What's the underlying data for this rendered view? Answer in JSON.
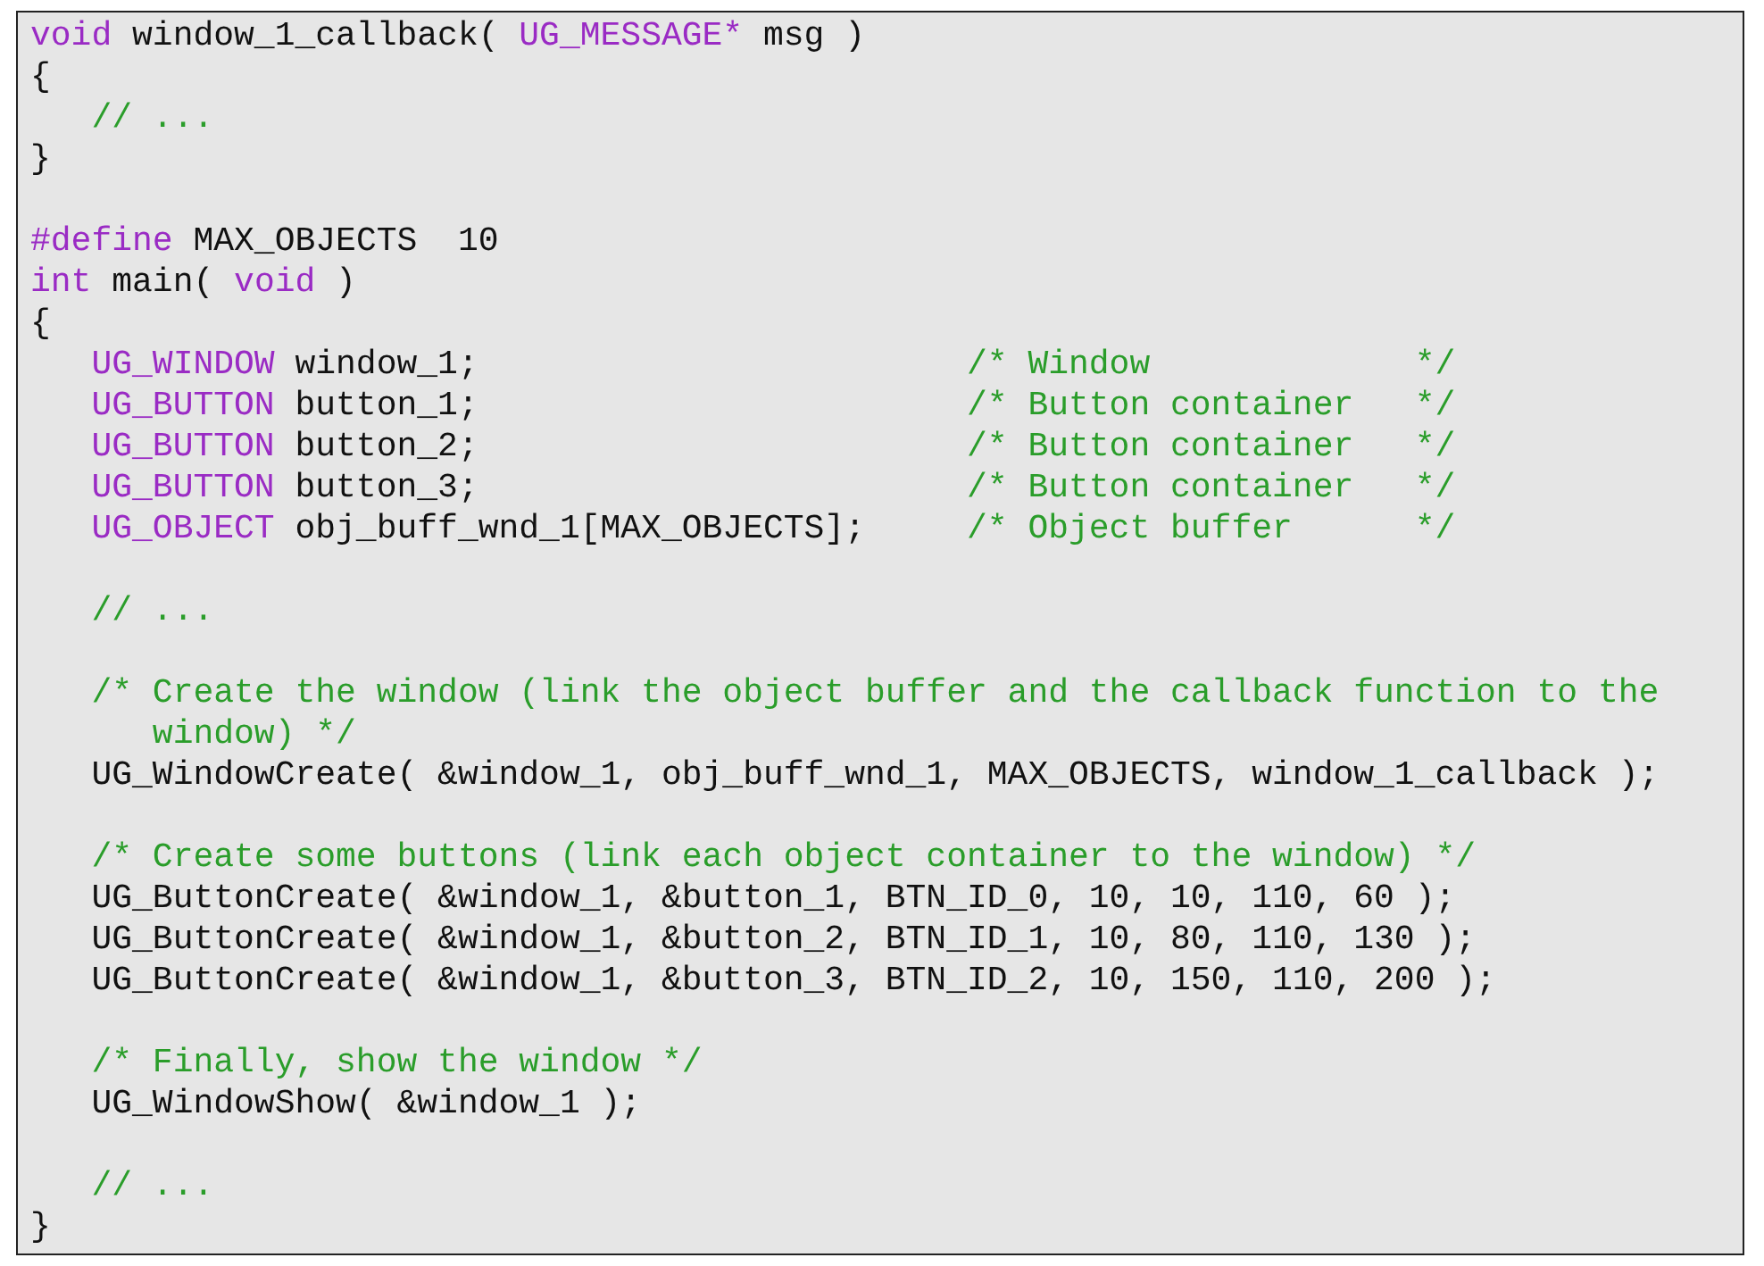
{
  "listing": {
    "blocks": [
      {
        "lines": [
          {
            "segments": [
              {
                "kind": "keyword",
                "text": "void"
              },
              {
                "kind": "plain",
                "text": " window_1_callback( "
              },
              {
                "kind": "type",
                "text": "UG_MESSAGE*"
              },
              {
                "kind": "plain",
                "text": " msg )"
              }
            ]
          },
          {
            "segments": [
              {
                "kind": "plain",
                "text": "{"
              }
            ]
          },
          {
            "segments": [
              {
                "kind": "comment",
                "text": "   // ..."
              }
            ]
          },
          {
            "segments": [
              {
                "kind": "plain",
                "text": "}"
              }
            ]
          }
        ]
      },
      {
        "lines": [
          {
            "segments": [
              {
                "kind": "keyword",
                "text": "#define"
              },
              {
                "kind": "plain",
                "text": " MAX_OBJECTS  10"
              }
            ]
          },
          {
            "segments": [
              {
                "kind": "keyword",
                "text": "int"
              },
              {
                "kind": "plain",
                "text": " main( "
              },
              {
                "kind": "keyword",
                "text": "void"
              },
              {
                "kind": "plain",
                "text": " )"
              }
            ]
          },
          {
            "segments": [
              {
                "kind": "plain",
                "text": "{"
              }
            ]
          },
          {
            "segments": [
              {
                "kind": "type",
                "text": "   UG_WINDOW"
              },
              {
                "kind": "plain",
                "text": " window_1;"
              },
              {
                "kind": "aligned_comment",
                "text": "/* Window             */"
              }
            ]
          },
          {
            "segments": [
              {
                "kind": "type",
                "text": "   UG_BUTTON"
              },
              {
                "kind": "plain",
                "text": " button_1;"
              },
              {
                "kind": "aligned_comment",
                "text": "/* Button container   */"
              }
            ]
          },
          {
            "segments": [
              {
                "kind": "type",
                "text": "   UG_BUTTON"
              },
              {
                "kind": "plain",
                "text": " button_2;"
              },
              {
                "kind": "aligned_comment",
                "text": "/* Button container   */"
              }
            ]
          },
          {
            "segments": [
              {
                "kind": "type",
                "text": "   UG_BUTTON"
              },
              {
                "kind": "plain",
                "text": " button_3;"
              },
              {
                "kind": "aligned_comment",
                "text": "/* Button container   */"
              }
            ]
          },
          {
            "segments": [
              {
                "kind": "type",
                "text": "   UG_OBJECT"
              },
              {
                "kind": "plain",
                "text": " obj_buff_wnd_1[MAX_OBJECTS];"
              },
              {
                "kind": "aligned_comment",
                "text": "/* Object buffer      */"
              }
            ]
          }
        ]
      },
      {
        "lines": [
          {
            "segments": [
              {
                "kind": "comment",
                "text": "   // ..."
              }
            ]
          }
        ]
      },
      {
        "lines": [
          {
            "segments": [
              {
                "kind": "comment",
                "text": "   /* Create the window (link the object buffer and the callback function to the"
              }
            ]
          },
          {
            "segments": [
              {
                "kind": "comment",
                "text": "      window) */"
              }
            ]
          },
          {
            "segments": [
              {
                "kind": "plain",
                "text": "   UG_WindowCreate( &window_1, obj_buff_wnd_1, MAX_OBJECTS, window_1_callback );"
              }
            ]
          }
        ]
      },
      {
        "lines": [
          {
            "segments": [
              {
                "kind": "comment",
                "text": "   /* Create some buttons (link each object container to the window) */"
              }
            ]
          },
          {
            "segments": [
              {
                "kind": "plain",
                "text": "   UG_ButtonCreate( &window_1, &button_1, BTN_ID_0, 10, 10, 110, 60 );"
              }
            ]
          },
          {
            "segments": [
              {
                "kind": "plain",
                "text": "   UG_ButtonCreate( &window_1, &button_2, BTN_ID_1, 10, 80, 110, 130 );"
              }
            ]
          },
          {
            "segments": [
              {
                "kind": "plain",
                "text": "   UG_ButtonCreate( &window_1, &button_3, BTN_ID_2, 10, 150, 110, 200 );"
              }
            ]
          }
        ]
      },
      {
        "lines": [
          {
            "segments": [
              {
                "kind": "comment",
                "text": "   /* Finally, show the window */"
              }
            ]
          },
          {
            "segments": [
              {
                "kind": "plain",
                "text": "   UG_WindowShow( &window_1 );"
              }
            ]
          }
        ]
      },
      {
        "lines": [
          {
            "segments": [
              {
                "kind": "comment",
                "text": "   // ..."
              }
            ]
          },
          {
            "segments": [
              {
                "kind": "plain",
                "text": "}"
              }
            ]
          }
        ]
      }
    ]
  }
}
